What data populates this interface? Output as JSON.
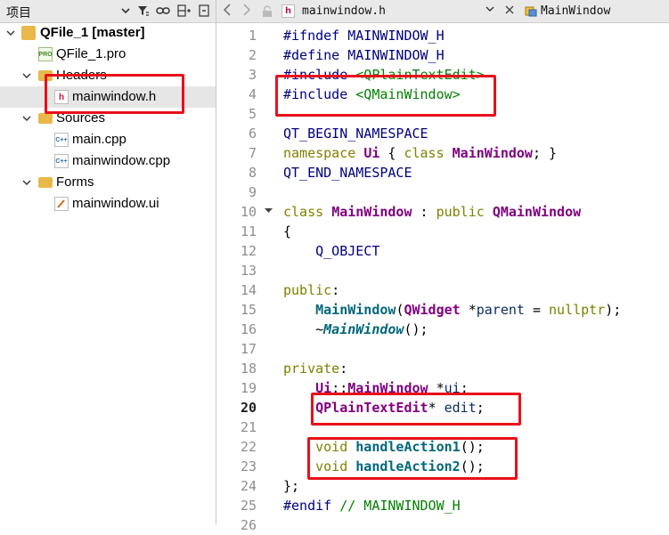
{
  "project_pane": {
    "title": "项目",
    "toolbar_icons": [
      "dropdown-icon",
      "filter-icon",
      "link-icon",
      "split-icon",
      "close-pane-icon"
    ],
    "tree": [
      {
        "label": "QFile_1 [master]",
        "icon": "project-icon",
        "expanded": true
      },
      {
        "label": "QFile_1.pro",
        "icon": "pro-file-icon"
      },
      {
        "label": "Headers",
        "icon": "folder-icon",
        "expanded": true
      },
      {
        "label": "mainwindow.h",
        "icon": "header-file-icon",
        "selected": true
      },
      {
        "label": "Sources",
        "icon": "folder-icon",
        "expanded": true
      },
      {
        "label": "main.cpp",
        "icon": "cpp-file-icon"
      },
      {
        "label": "mainwindow.cpp",
        "icon": "cpp-file-icon"
      },
      {
        "label": "Forms",
        "icon": "folder-icon",
        "expanded": true
      },
      {
        "label": "mainwindow.ui",
        "icon": "ui-file-icon"
      }
    ]
  },
  "editor_toolbar": {
    "file_name": "mainwindow.h",
    "symbol": "MainWindow",
    "header_glyph": "h",
    "cpp_glyph": "C++",
    "pro_glyph": "PRO"
  },
  "editor": {
    "current_line": 20,
    "line_numbers": [
      "1",
      "2",
      "3",
      "4",
      "5",
      "6",
      "7",
      "8",
      "9",
      "10",
      "11",
      "12",
      "13",
      "14",
      "15",
      "16",
      "17",
      "18",
      "19",
      "20",
      "21",
      "22",
      "23",
      "24",
      "25",
      "26"
    ],
    "lines": [
      "#ifndef MAINWINDOW_H",
      "#define MAINWINDOW_H",
      "#include <QPlainTextEdit>",
      "#include <QMainWindow>",
      "",
      "QT_BEGIN_NAMESPACE",
      "namespace Ui { class MainWindow; }",
      "QT_END_NAMESPACE",
      "",
      "class MainWindow : public QMainWindow",
      "{",
      "    Q_OBJECT",
      "",
      "public:",
      "    MainWindow(QWidget *parent = nullptr);",
      "    ~MainWindow();",
      "",
      "private:",
      "    Ui::MainWindow *ui;",
      "    QPlainTextEdit* edit;",
      "",
      "    void handleAction1();",
      "    void handleAction2();",
      "};",
      "#endif // MAINWINDOW_H",
      ""
    ]
  },
  "colors": {
    "highlight_box": "#e8101a",
    "selection_bg": "#e6e6e6",
    "preprocessor": "#000080",
    "include_path": "#008000",
    "keyword": "#808000",
    "class_name": "#800080",
    "function": "#00677c"
  }
}
